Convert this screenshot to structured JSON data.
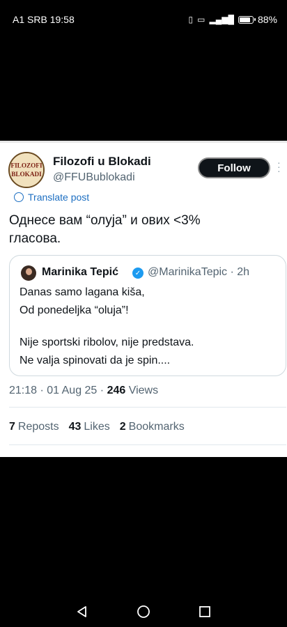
{
  "status": {
    "carrier_time": "A1 SRB 19:58",
    "battery": "88%",
    "battery_level": 0.88,
    "icons": [
      "vibrate-icon",
      "volte-icon",
      "signal-4g-icon",
      "battery-icon"
    ]
  },
  "post": {
    "author_name": "Filozofi u Blokadi",
    "author_handle": "@FFUBublokadi",
    "avatar_text": [
      "FILOZOFI",
      "BLOKADI"
    ],
    "follow_label": "Follow",
    "translate_label": "Translate post",
    "text_line1": "Однесе вам “олуја” и ових <3%",
    "text_line2": "гласова.",
    "timestamp": "21:18 · 01 Aug 25 ·",
    "views_count": "246",
    "views_label": "Views"
  },
  "quote": {
    "author_name": "Marinika Tepić",
    "author_handle": "@MarinikaTepic · 2h",
    "line1": "Danas samo lagana kiša,",
    "line2": "Od ponedeljka “oluja”!",
    "line3": "Nije sportski ribolov, nije predstava.",
    "line4": "Ne valja spinovati da je spin...."
  },
  "stats": {
    "reposts_count": "7",
    "reposts_label": "Reposts",
    "likes_count": "43",
    "likes_label": "Likes",
    "bookmarks_count": "2",
    "bookmarks_label": "Bookmarks"
  },
  "colors": {
    "accent_link": "#1d6fc2",
    "verified": "#1d9bf0",
    "muted_text": "#536471"
  }
}
